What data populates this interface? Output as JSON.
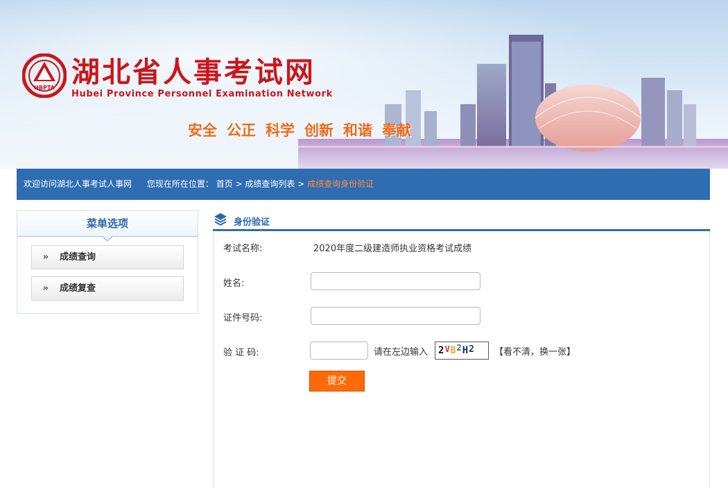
{
  "header": {
    "site_name_cn": "湖北省人事考试网",
    "site_name_en": "Hubei Province Personnel Examination Network",
    "logo_text": "HBPTA",
    "slogan": [
      "安全",
      "公正",
      "科学",
      "创新",
      "和谐",
      "奉献"
    ]
  },
  "navbar": {
    "welcome": "欢迎访问湖北人事考试人事网",
    "location_label": "您现在所在位置：",
    "breadcrumbs": [
      "首页",
      "成绩查询列表",
      "成绩查询身份验证"
    ],
    "separator": ">"
  },
  "sidebar": {
    "title": "菜单选项",
    "items": [
      {
        "label": "成绩查询",
        "arrow": "»"
      },
      {
        "label": "成绩复查",
        "arrow": "»"
      }
    ]
  },
  "panel": {
    "title": "身份验证",
    "exam_label": "考试名称:",
    "exam_value": "2020年度二级建造师执业资格考试成绩",
    "name_label": "姓名:",
    "name_value": "",
    "id_label": "证件号码:",
    "id_value": "",
    "captcha_label": "验 证 码:",
    "captcha_value": "",
    "captcha_hint": "请在左边输入",
    "captcha_chars": [
      "2",
      "V",
      "B",
      "2",
      "H",
      "2"
    ],
    "refresh_text": "【看不清，换一张】",
    "submit_label": "提交"
  },
  "colors": {
    "brand_red": "#c8171d",
    "nav_blue": "#2f6db2",
    "slogan_orange": "#ec6a1a",
    "breadcrumb_current": "#ff8c3a",
    "submit_orange": "#ff6a06"
  }
}
